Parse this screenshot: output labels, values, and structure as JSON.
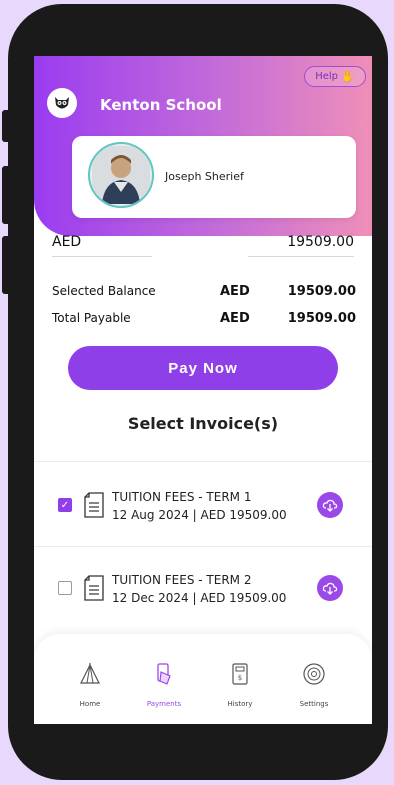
{
  "header": {
    "school_name": "Kenton School",
    "help_label": "Help"
  },
  "student": {
    "name": "Joseph Sherief"
  },
  "amount_row": {
    "currency": "AED",
    "value": "19509.00"
  },
  "balances": [
    {
      "label": "Selected Balance",
      "currency": "AED",
      "value": "19509.00"
    },
    {
      "label": "Total Payable",
      "currency": "AED",
      "value": "19509.00"
    }
  ],
  "pay_button_label": "Pay Now",
  "invoices_title": "Select Invoice(s)",
  "invoices": [
    {
      "title": "TUITION FEES - TERM 1",
      "detail": "12 Aug 2024 | AED 19509.00",
      "checked": true
    },
    {
      "title": "TUITION FEES - TERM 2",
      "detail": "12 Dec 2024 | AED 19509.00",
      "checked": false
    }
  ],
  "nav": [
    {
      "label": "Home",
      "icon": "home-icon",
      "active": false
    },
    {
      "label": "Payments",
      "icon": "payments-icon",
      "active": true
    },
    {
      "label": "History",
      "icon": "history-icon",
      "active": false
    },
    {
      "label": "Settings",
      "icon": "settings-icon",
      "active": false
    }
  ],
  "colors": {
    "accent": "#8f3fe8",
    "header_start": "#9a3cf0",
    "header_end": "#ef8fb8"
  }
}
